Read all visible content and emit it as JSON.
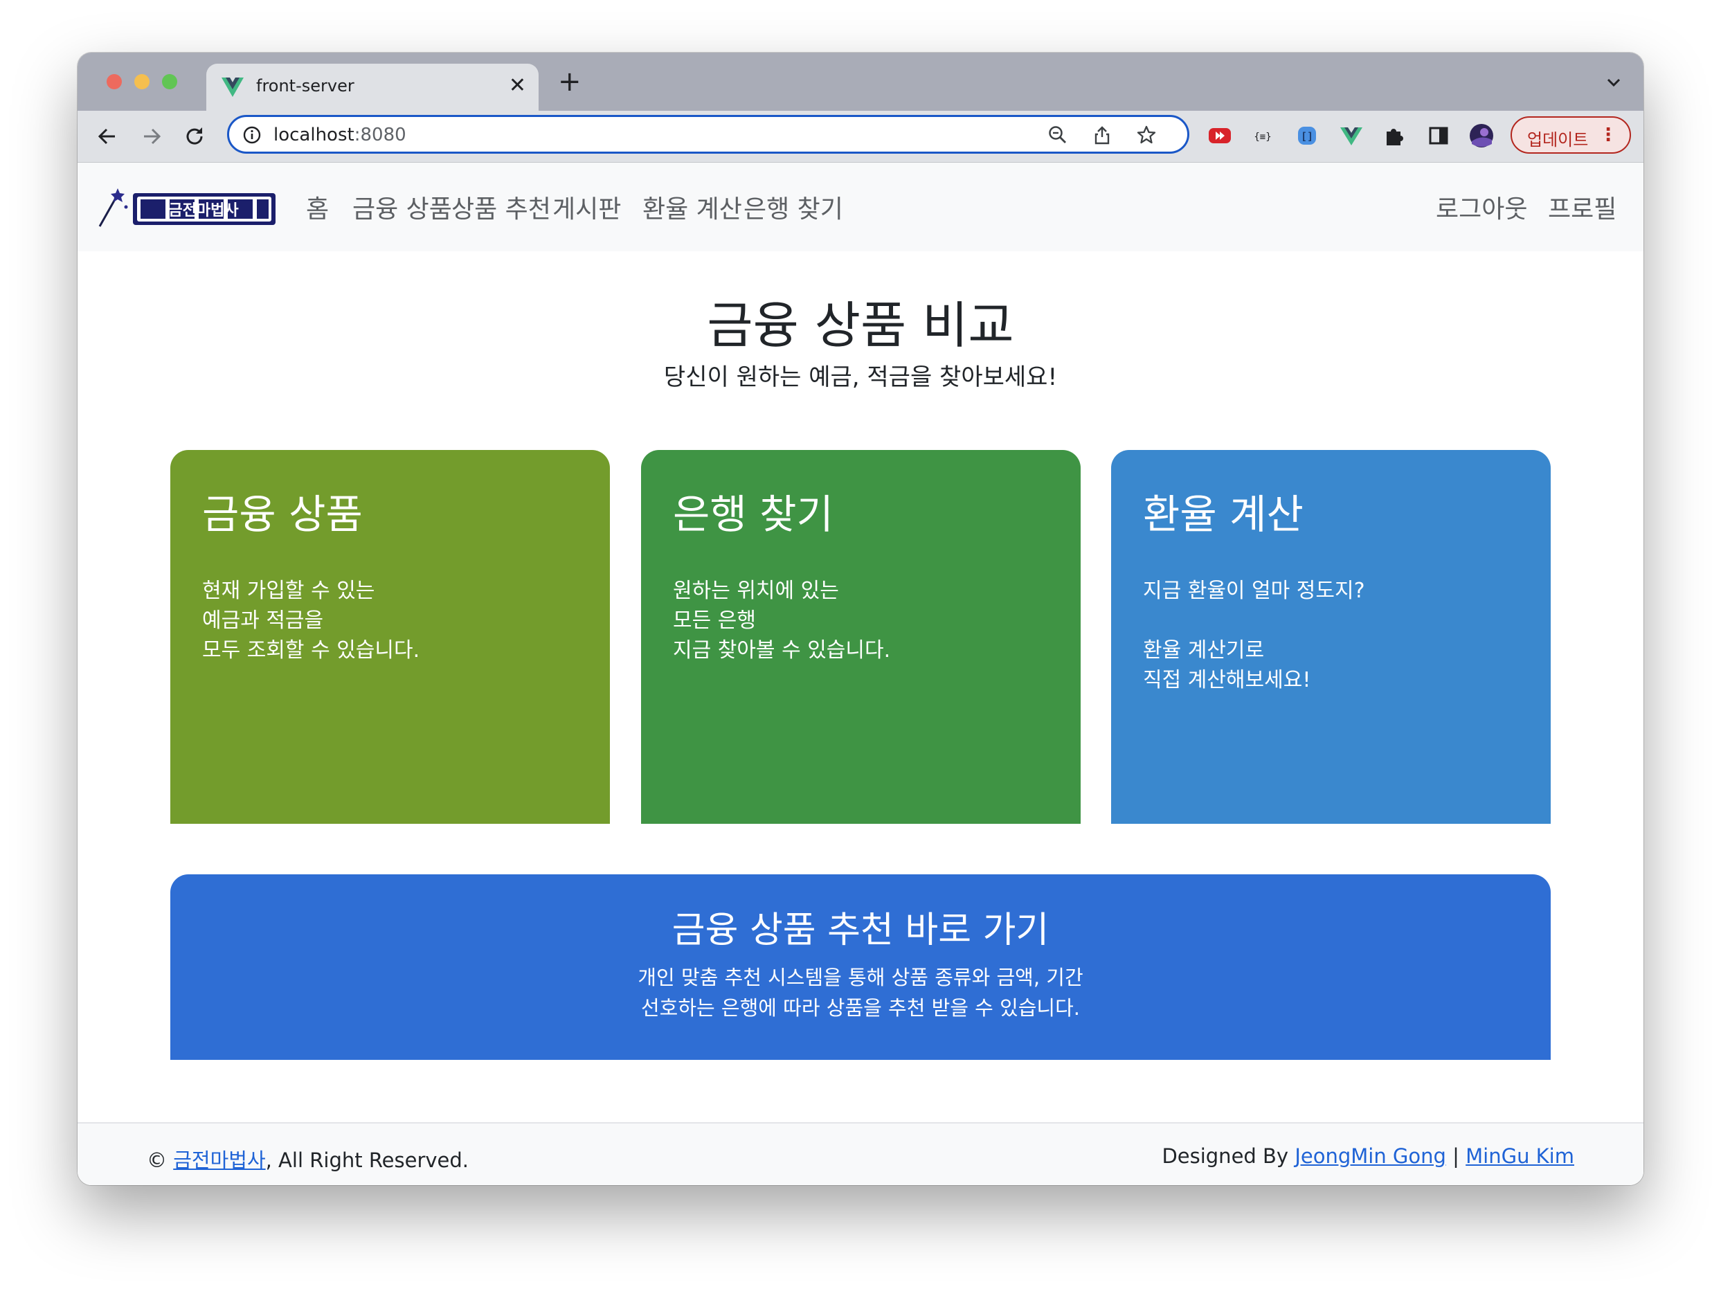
{
  "browser": {
    "tab_title": "front-server",
    "url_host": "localhost",
    "url_port": ":8080",
    "update_label": "업데이트",
    "icons": [
      "back-icon",
      "forward-icon",
      "reload-icon",
      "info-icon",
      "zoom-out-icon",
      "share-icon",
      "bookmark-star-icon",
      "extensions-icon",
      "side-panel-icon",
      "profile-avatar",
      "more-menu-icon"
    ]
  },
  "navbar": {
    "items": [
      {
        "label": "홈"
      },
      {
        "label": "금융 상품"
      },
      {
        "label": "상품 추천"
      },
      {
        "label": "게시판"
      },
      {
        "label": "환율 계산"
      },
      {
        "label": "은행 찾기"
      }
    ],
    "right_items": [
      {
        "label": "로그아웃"
      },
      {
        "label": "프로필"
      }
    ]
  },
  "hero": {
    "title": "금융 상품 비교",
    "subtitle": "당신이 원하는 예금, 적금을 찾아보세요!"
  },
  "cards": [
    {
      "title": "금융 상품",
      "lines": [
        "현재 가입할 수 있는",
        "예금과 적금을",
        "모두 조회할 수 있습니다."
      ],
      "color": "#739c2c"
    },
    {
      "title": "은행 찾기",
      "lines": [
        "원하는 위치에 있는",
        "모든 은행",
        "지금 찾아볼 수 있습니다."
      ],
      "color": "#3f9444"
    },
    {
      "title": "환율 계산",
      "lines": [
        "지금 환율이 얼마 정도지?",
        "",
        "환율 계산기로",
        "직접 계산해보세요!"
      ],
      "color": "#3a88ce"
    }
  ],
  "recommend": {
    "title": "금융 상품 추천 바로 가기",
    "lines": [
      "개인 맞춤 추천 시스템을 통해 상품 종류와 금액, 기간",
      "선호하는 은행에 따라 상품을 추천 받을 수 있습니다."
    ],
    "color": "#2f6ed4"
  },
  "footer": {
    "copyright_symbol": "©",
    "brand_link": "금전마법사",
    "rights": ", All Right Reserved.",
    "designed_by": "Designed By",
    "author1": "JeongMin Gong",
    "separator": "|",
    "author2": "MinGu Kim"
  },
  "colors": {
    "accent": "#1a57c7",
    "link": "#1f63d6"
  }
}
